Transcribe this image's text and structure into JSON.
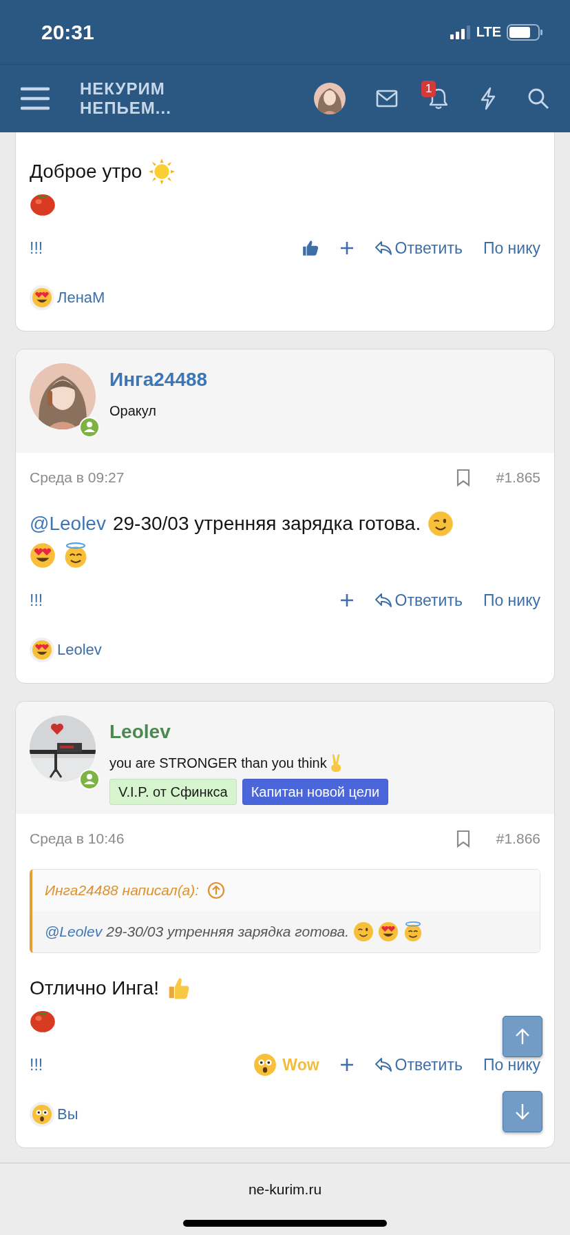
{
  "status_bar": {
    "time": "20:31",
    "network": "LTE"
  },
  "nav": {
    "logo": [
      "НЕКУРИМ",
      "НЕПЬЕМ..."
    ],
    "notifications_badge": "1"
  },
  "posts": [
    {
      "body": [
        [
          {
            "kind": "text",
            "text": "Доброе утро"
          },
          {
            "kind": "sun"
          }
        ],
        [
          {
            "kind": "tomato"
          }
        ]
      ],
      "actions": {
        "report": "!!!",
        "reaction": {
          "kind": "like"
        },
        "reply": "Ответить",
        "by_nick": "По нику"
      },
      "reactions": [
        {
          "kind": "heart-eyes",
          "user": "ЛенаМ"
        }
      ]
    },
    {
      "author": {
        "name": "Инга24488",
        "color": "#3d76b3",
        "online": true,
        "title": [
          {
            "kind": "text",
            "text": "Оракул"
          }
        ]
      },
      "meta": {
        "date": "Среда в 09:27",
        "number": "#1.865"
      },
      "body": [
        [
          {
            "kind": "mention",
            "text": "@Leolev"
          },
          {
            "kind": "text",
            "text": "29-30/03 утренняя зарядка готова."
          },
          {
            "kind": "wink"
          }
        ],
        [
          {
            "kind": "heart-eyes"
          },
          {
            "kind": "halo"
          }
        ]
      ],
      "actions": {
        "report": "!!!",
        "reply": "Ответить",
        "by_nick": "По нику"
      },
      "reactions": [
        {
          "kind": "heart-eyes",
          "user": "Leolev"
        }
      ]
    },
    {
      "author": {
        "name": "Leolev",
        "color": "#4a8a50",
        "online": true,
        "title": [
          {
            "kind": "text",
            "text": "you are STRONGER than you think"
          },
          {
            "kind": "victory"
          }
        ],
        "tags": [
          {
            "label": "V.I.P. от Сфинкса",
            "color": "#d6f5cf"
          },
          {
            "label": "Капитан новой цели",
            "color": "#4a66da"
          }
        ]
      },
      "meta": {
        "date": "Среда в 10:46",
        "number": "#1.866"
      },
      "quote": {
        "author": "Инга24488 написал(а):",
        "body": [
          {
            "kind": "mention",
            "text": "@Leolev"
          },
          {
            "kind": "text",
            "text": "29-30/03 утренняя зарядка готова."
          },
          {
            "kind": "wink"
          },
          {
            "kind": "heart-eyes"
          },
          {
            "kind": "halo"
          }
        ]
      },
      "body": [
        [
          {
            "kind": "text",
            "text": "Отлично Инга!"
          },
          {
            "kind": "thumbs-up"
          }
        ],
        [
          {
            "kind": "tomato"
          }
        ]
      ],
      "actions": {
        "report": "!!!",
        "reaction": {
          "kind": "wow",
          "label": "Wow"
        },
        "reply": "Ответить",
        "by_nick": "По нику"
      },
      "reactions": [
        {
          "kind": "wow",
          "user": "Вы"
        }
      ]
    }
  ],
  "footer": {
    "url": "ne-kurim.ru"
  }
}
